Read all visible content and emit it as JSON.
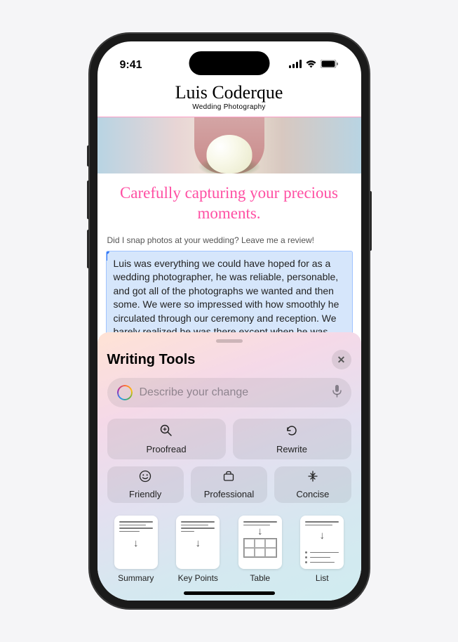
{
  "status_bar": {
    "time": "9:41"
  },
  "page": {
    "title": "Luis Coderque",
    "subtitle": "Wedding Photography",
    "tagline": "Carefully capturing your precious moments.",
    "review_prompt": "Did I snap photos at your wedding? Leave me a review!",
    "selected_text": "Luis was everything we could have hoped for as a wedding photographer, he was reliable, personable, and got all of the photographs we wanted and then some. We were so impressed with how smoothly he circulated through our ceremony and reception. We barely realized he was there except when he was very"
  },
  "sheet": {
    "title": "Writing Tools",
    "input_placeholder": "Describe your change",
    "actions": {
      "proofread": "Proofread",
      "rewrite": "Rewrite",
      "friendly": "Friendly",
      "professional": "Professional",
      "concise": "Concise"
    },
    "formats": {
      "summary": "Summary",
      "key_points": "Key Points",
      "table": "Table",
      "list": "List"
    }
  }
}
